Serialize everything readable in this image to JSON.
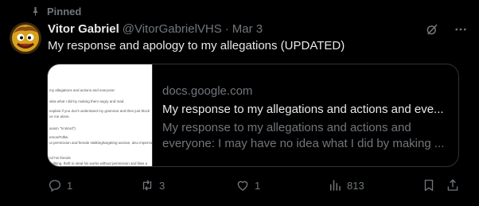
{
  "pinned_label": "Pinned",
  "author": {
    "display_name": "Vitor Gabriel",
    "handle": "@VitorGabrielVHS",
    "separator": "·",
    "date": "Mar 3"
  },
  "tweet": {
    "text": "My response and apology to my allegations (UPDATED)"
  },
  "card": {
    "domain": "docs.google.com",
    "title": "My response to my allegations and actions and eve...",
    "description_line1": "My response to my allegations and actions and",
    "description_line2": "everyone: I may have no idea what I did by making ...",
    "preview_lines": [
      "my allegations and actions and everyone:",
      "idea what I did by making them angry and mad.",
      "explain if you don't understand my grammar and then just block",
      "ve me alone.",
      "asism \"N Word\")",
      "emon/Fdtlw",
      "ut permission and female stalking/targeting woman, also imperso",
      "nd his friends",
      "stalking, theft to steal his works without permission and fake a"
    ]
  },
  "actions": {
    "replies": "1",
    "reposts": "3",
    "likes": "1",
    "views": "813"
  },
  "colors": {
    "background": "#000000",
    "text": "#e7e9ea",
    "muted": "#71767b",
    "border": "#2f3336"
  }
}
